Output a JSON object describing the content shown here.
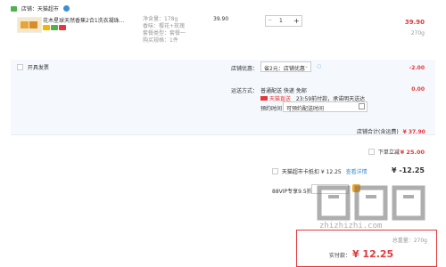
{
  "store": {
    "label": "店铺：天猫超市"
  },
  "item": {
    "title": "花木星球天然香蕉2合1洗衣凝珠...",
    "attr_weight": "净含量：178g",
    "attr_scent": "香味：樱花+玫瑰",
    "attr_package": "套餐类型：套餐一",
    "attr_count": "购买规格：1件",
    "unit_price": "39.90",
    "qty": "1",
    "minus": "−",
    "plus": "+",
    "subtotal": "39.90",
    "weight": "270g"
  },
  "invoice": {
    "label": "开具发票"
  },
  "promo": {
    "label": "店铺优惠：",
    "value": "省2元：店铺优惠",
    "amount": "-2.00"
  },
  "delivery": {
    "label": "运送方式：",
    "mode": "普通配送 快递 免邮",
    "tmall_badge": "天猫直送",
    "tmall_text": "23:59前付款，承诺明天送达",
    "appoint_label": "预约时间：",
    "appoint_value": "可预约配送时间",
    "amount": "0.00"
  },
  "store_total": {
    "label": "店铺合计(含运费)",
    "value": "¥ 37.90"
  },
  "coupon": {
    "label": "下单立减",
    "value": "- ¥ 25.00"
  },
  "card": {
    "label": "天猫超市卡抵扣 ¥ 12.25",
    "link": "查看详情",
    "value": "¥ -12.25"
  },
  "vip": {
    "label": "88VIP专享9.5折"
  },
  "summary": {
    "weight_label": "总重量：270g",
    "pay_label": "实付款：",
    "pay_value": "¥ 12.25"
  },
  "watermark": {
    "text": "zhizhizhi.com"
  },
  "colors": {
    "accent": "#e4393c",
    "link": "#3c8dd5",
    "vip": "#f5a623"
  }
}
